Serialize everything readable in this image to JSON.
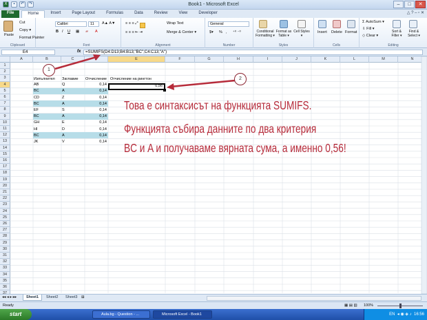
{
  "window": {
    "title": "Book1 - Microsoft Excel"
  },
  "ribbon_tabs": [
    "File",
    "Home",
    "Insert",
    "Page Layout",
    "Formulas",
    "Data",
    "Review",
    "View",
    "Developer"
  ],
  "clipboard": {
    "paste": "Paste",
    "cut": "Cut",
    "copy": "Copy ▾",
    "format_painter": "Format Painter",
    "label": "Clipboard"
  },
  "font": {
    "name": "Calibri",
    "size": "11",
    "label": "Font",
    "bold": "B",
    "italic": "I",
    "underline": "U"
  },
  "alignment": {
    "wrap": "Wrap Text",
    "merge": "Merge & Center ▾",
    "label": "Alignment"
  },
  "number": {
    "format": "General",
    "label": "Number",
    "pct": "%",
    "comma": ","
  },
  "styles": {
    "conditional": "Conditional Formatting ▾",
    "table": "Format as Table ▾",
    "cell": "Cell Styles ▾",
    "label": "Styles"
  },
  "cells": {
    "insert": "Insert",
    "delete": "Delete",
    "format": "Format",
    "label": "Cells"
  },
  "editing": {
    "autosum": "AutoSum ▾",
    "fill": "Fill ▾",
    "clear": "Clear ▾",
    "sort": "Sort & Filter ▾",
    "find": "Find & Select ▾",
    "label": "Editing"
  },
  "formula_bar": {
    "name_box": "E4",
    "fx": "fx",
    "formula": "=SUMIFS(D4:D13;B4:B13;\"BC\";C4:C13;\"A\")"
  },
  "columns": [
    "A",
    "B",
    "C",
    "D",
    "E",
    "F",
    "G",
    "H",
    "I",
    "J",
    "K",
    "L",
    "M",
    "N",
    "O"
  ],
  "rows": [
    "1",
    "2",
    "3",
    "4",
    "5",
    "6",
    "7",
    "8",
    "9",
    "10",
    "11",
    "12",
    "13",
    "14",
    "15",
    "16",
    "17",
    "18",
    "19",
    "20",
    "21",
    "22",
    "23",
    "24",
    "25",
    "26",
    "27",
    "28",
    "29",
    "30",
    "31",
    "32",
    "33",
    "34",
    "35",
    "36",
    "37",
    "38"
  ],
  "table": {
    "headers": [
      "Изпълнител",
      "Заглавие",
      "Отчисление",
      "Отчисление на рингтон"
    ],
    "result": "0,56",
    "rows": [
      {
        "b": "AB",
        "c": "Q",
        "d": "0,14",
        "teal": false
      },
      {
        "b": "BC",
        "c": "A",
        "d": "0,14",
        "teal": true
      },
      {
        "b": "CD",
        "c": "Z",
        "d": "0,14",
        "teal": false
      },
      {
        "b": "BC",
        "c": "A",
        "d": "0,14",
        "teal": true
      },
      {
        "b": "EF",
        "c": "S",
        "d": "0,14",
        "teal": false
      },
      {
        "b": "BC",
        "c": "A",
        "d": "0,14",
        "teal": true
      },
      {
        "b": "GH",
        "c": "E",
        "d": "0,14",
        "teal": false
      },
      {
        "b": "HI",
        "c": "D",
        "d": "0,14",
        "teal": false
      },
      {
        "b": "BC",
        "c": "A",
        "d": "0,14",
        "teal": true
      },
      {
        "b": "JK",
        "c": "V",
        "d": "0,14",
        "teal": false
      }
    ]
  },
  "annotation": {
    "line1": "Това е синтаксисът на функцията SUMIFS.",
    "line2": "Функцията събира данните по два критерия",
    "line3": "BC и A и получаваме вярната сума, а именно 0,56!",
    "marker1": "1",
    "marker2": "2",
    "color": "#b62b3a"
  },
  "sheets": [
    "Sheet1",
    "Sheet2",
    "Sheet3"
  ],
  "status": {
    "ready": "Ready",
    "zoom": "100%"
  },
  "taskbar": {
    "start": "start",
    "items": [
      "Aula.bg - Question - ...",
      "Microsoft Excel - Book1"
    ],
    "lang": "EN",
    "time": "16:56"
  }
}
